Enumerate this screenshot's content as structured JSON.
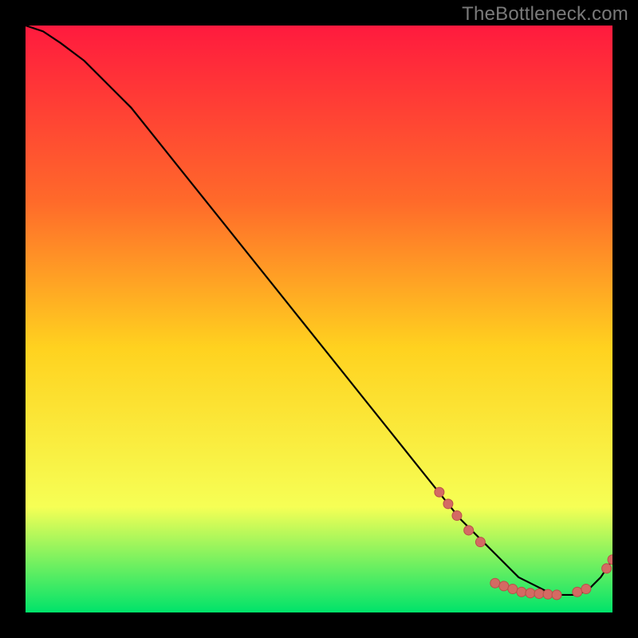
{
  "watermark": "TheBottleneck.com",
  "colors": {
    "background": "#000000",
    "gradient_top": "#ff1a3e",
    "gradient_mid_upper": "#ff6a2a",
    "gradient_mid": "#ffd21f",
    "gradient_lower": "#f6ff55",
    "gradient_bottom": "#00e36a",
    "curve": "#000000",
    "marker_fill": "#d46a63",
    "marker_stroke": "#b94f48"
  },
  "chart_data": {
    "type": "line",
    "title": "",
    "xlabel": "",
    "ylabel": "",
    "xlim": [
      0,
      100
    ],
    "ylim": [
      0,
      100
    ],
    "series": [
      {
        "name": "curve",
        "x": [
          0,
          3,
          6,
          10,
          14,
          18,
          22,
          26,
          30,
          34,
          38,
          42,
          46,
          50,
          54,
          58,
          62,
          66,
          70,
          74,
          78,
          80,
          82,
          84,
          86,
          88,
          90,
          92,
          94,
          96,
          98,
          100
        ],
        "y": [
          100,
          99,
          97,
          94,
          90,
          86,
          81,
          76,
          71,
          66,
          61,
          56,
          51,
          46,
          41,
          36,
          31,
          26,
          21,
          16,
          12,
          10,
          8,
          6,
          5,
          4,
          3,
          3,
          3,
          4,
          6,
          9
        ]
      }
    ],
    "markers": [
      {
        "name": "segment-upper",
        "points": [
          {
            "x": 70.5,
            "y": 20.5
          },
          {
            "x": 72.0,
            "y": 18.5
          },
          {
            "x": 73.5,
            "y": 16.5
          },
          {
            "x": 75.5,
            "y": 14.0
          },
          {
            "x": 77.5,
            "y": 12.0
          }
        ]
      },
      {
        "name": "segment-bottom",
        "points": [
          {
            "x": 80.0,
            "y": 5.0
          },
          {
            "x": 81.5,
            "y": 4.5
          },
          {
            "x": 83.0,
            "y": 4.0
          },
          {
            "x": 84.5,
            "y": 3.5
          },
          {
            "x": 86.0,
            "y": 3.3
          },
          {
            "x": 87.5,
            "y": 3.2
          },
          {
            "x": 89.0,
            "y": 3.1
          },
          {
            "x": 90.5,
            "y": 3.0
          },
          {
            "x": 94.0,
            "y": 3.5
          },
          {
            "x": 95.5,
            "y": 4.0
          }
        ]
      },
      {
        "name": "segment-tail",
        "points": [
          {
            "x": 99.0,
            "y": 7.5
          },
          {
            "x": 100.0,
            "y": 9.0
          }
        ]
      }
    ]
  }
}
